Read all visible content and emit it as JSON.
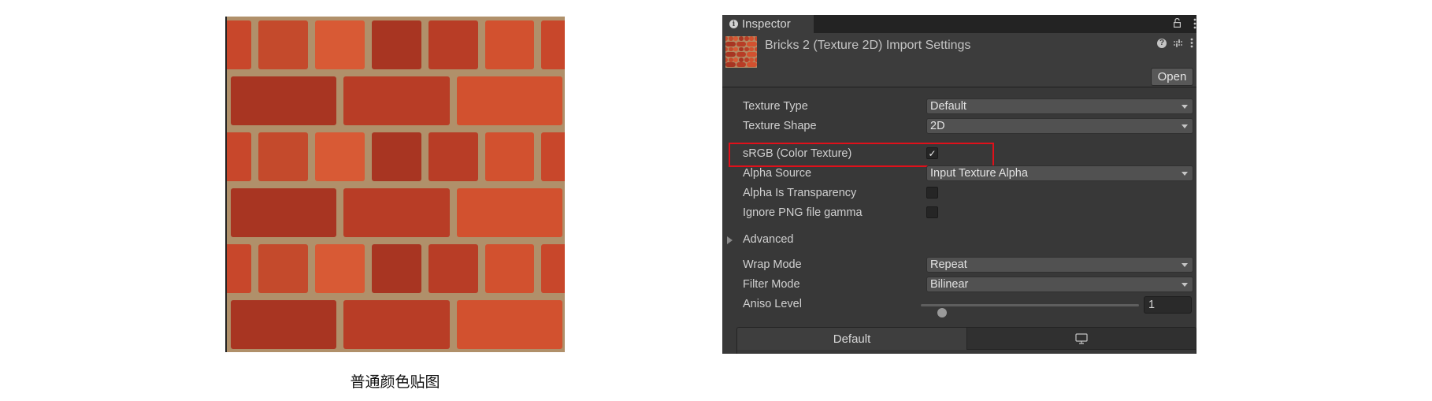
{
  "caption": "普通颜色贴图",
  "texture_preview": {
    "name": "brick-texture-preview"
  },
  "inspector": {
    "tab_label": "Inspector",
    "tab_icon": "info-icon",
    "lock_icon": "lock-icon",
    "menu_icon": "kebab-menu-icon",
    "header": {
      "title": "Bricks 2 (Texture 2D) Import Settings",
      "help_icon": "help-icon",
      "presets_icon": "sliders-icon",
      "menu_icon": "kebab-menu-icon",
      "open_label": "Open"
    },
    "fields": {
      "texture_type": {
        "label": "Texture Type",
        "value": "Default"
      },
      "texture_shape": {
        "label": "Texture Shape",
        "value": "2D"
      },
      "srgb": {
        "label": "sRGB (Color Texture)",
        "checked": true,
        "check_glyph": "✓"
      },
      "alpha_source": {
        "label": "Alpha Source",
        "value": "Input Texture Alpha"
      },
      "alpha_is_transparency": {
        "label": "Alpha Is Transparency",
        "checked": false
      },
      "ignore_png_gamma": {
        "label": "Ignore PNG file gamma",
        "checked": false
      },
      "advanced": {
        "label": "Advanced",
        "expanded": false
      },
      "wrap_mode": {
        "label": "Wrap Mode",
        "value": "Repeat"
      },
      "filter_mode": {
        "label": "Filter Mode",
        "value": "Bilinear"
      },
      "aniso_level": {
        "label": "Aniso Level",
        "value": "1",
        "min": 0,
        "max": 16
      }
    },
    "platform_tabs": [
      {
        "label": "Default",
        "active": true
      },
      {
        "label": "",
        "icon": "monitor-icon",
        "active": false
      }
    ],
    "highlight_color": "#e0101a"
  }
}
